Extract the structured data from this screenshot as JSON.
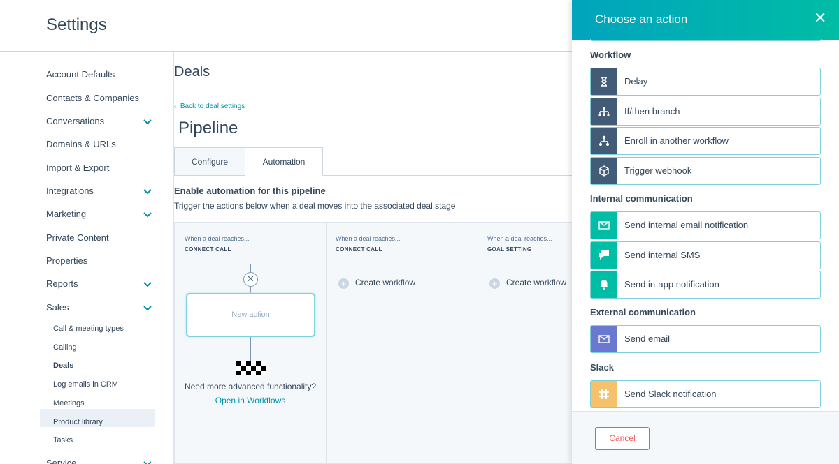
{
  "header": {
    "title": "Settings"
  },
  "sidebar": {
    "items": [
      {
        "label": "Account Defaults"
      },
      {
        "label": "Contacts & Companies"
      },
      {
        "label": "Conversations"
      },
      {
        "label": "Domains & URLs"
      },
      {
        "label": "Import & Export"
      },
      {
        "label": "Integrations"
      },
      {
        "label": "Marketing"
      },
      {
        "label": "Private Content"
      },
      {
        "label": "Properties"
      },
      {
        "label": "Reports"
      },
      {
        "label": "Sales"
      }
    ],
    "sales_subitems": [
      {
        "label": "Call & meeting types"
      },
      {
        "label": "Calling"
      },
      {
        "label": "Deals"
      },
      {
        "label": "Log emails in CRM"
      },
      {
        "label": "Meetings"
      },
      {
        "label": "Product library"
      },
      {
        "label": "Tasks"
      }
    ],
    "cut_item": {
      "label": "Service"
    },
    "active_item": "Deals"
  },
  "main": {
    "section_title": "Deals",
    "back_link": "Back to deal settings",
    "page_title": "Pipeline",
    "tabs": [
      {
        "label": "Configure"
      },
      {
        "label": "Automation"
      }
    ],
    "active_tab": "Automation",
    "enable_heading": "Enable automation for this pipeline",
    "enable_subtext": "Trigger the actions below when a deal moves into the associated deal stage",
    "stages": [
      {
        "when": "When a deal reaches...",
        "name": "CONNECT CALL"
      },
      {
        "when": "When a deal reaches...",
        "name": "CONNECT CALL",
        "action": "Create workflow"
      },
      {
        "when": "When a deal reaches...",
        "name": "GOAL SETTING",
        "action": "Create workflow"
      }
    ],
    "new_action_label": "New action",
    "need_more": "Need more advanced functionality?",
    "open_workflows": "Open in Workflows"
  },
  "panel": {
    "title": "Choose an action",
    "sections": [
      {
        "heading": "Workflow",
        "actions": [
          {
            "label": "Delay",
            "icon": "hourglass-icon"
          },
          {
            "label": "If/then branch",
            "icon": "branch-icon"
          },
          {
            "label": "Enroll in another workflow",
            "icon": "workflow-icon"
          },
          {
            "label": "Trigger webhook",
            "icon": "cube-icon"
          }
        ]
      },
      {
        "heading": "Internal communication",
        "actions": [
          {
            "label": "Send internal email notification",
            "icon": "envelope-icon"
          },
          {
            "label": "Send internal SMS",
            "icon": "chat-icon"
          },
          {
            "label": "Send in-app notification",
            "icon": "bell-icon"
          }
        ]
      },
      {
        "heading": "External communication",
        "actions": [
          {
            "label": "Send email",
            "icon": "envelope-icon"
          }
        ]
      },
      {
        "heading": "Slack",
        "actions": [
          {
            "label": "Send Slack notification",
            "icon": "slack-icon"
          }
        ]
      }
    ],
    "cancel_label": "Cancel"
  },
  "colors": {
    "accent": "#00a4bd",
    "link": "#0091ae",
    "danger": "#f2545b",
    "text": "#33475b"
  }
}
